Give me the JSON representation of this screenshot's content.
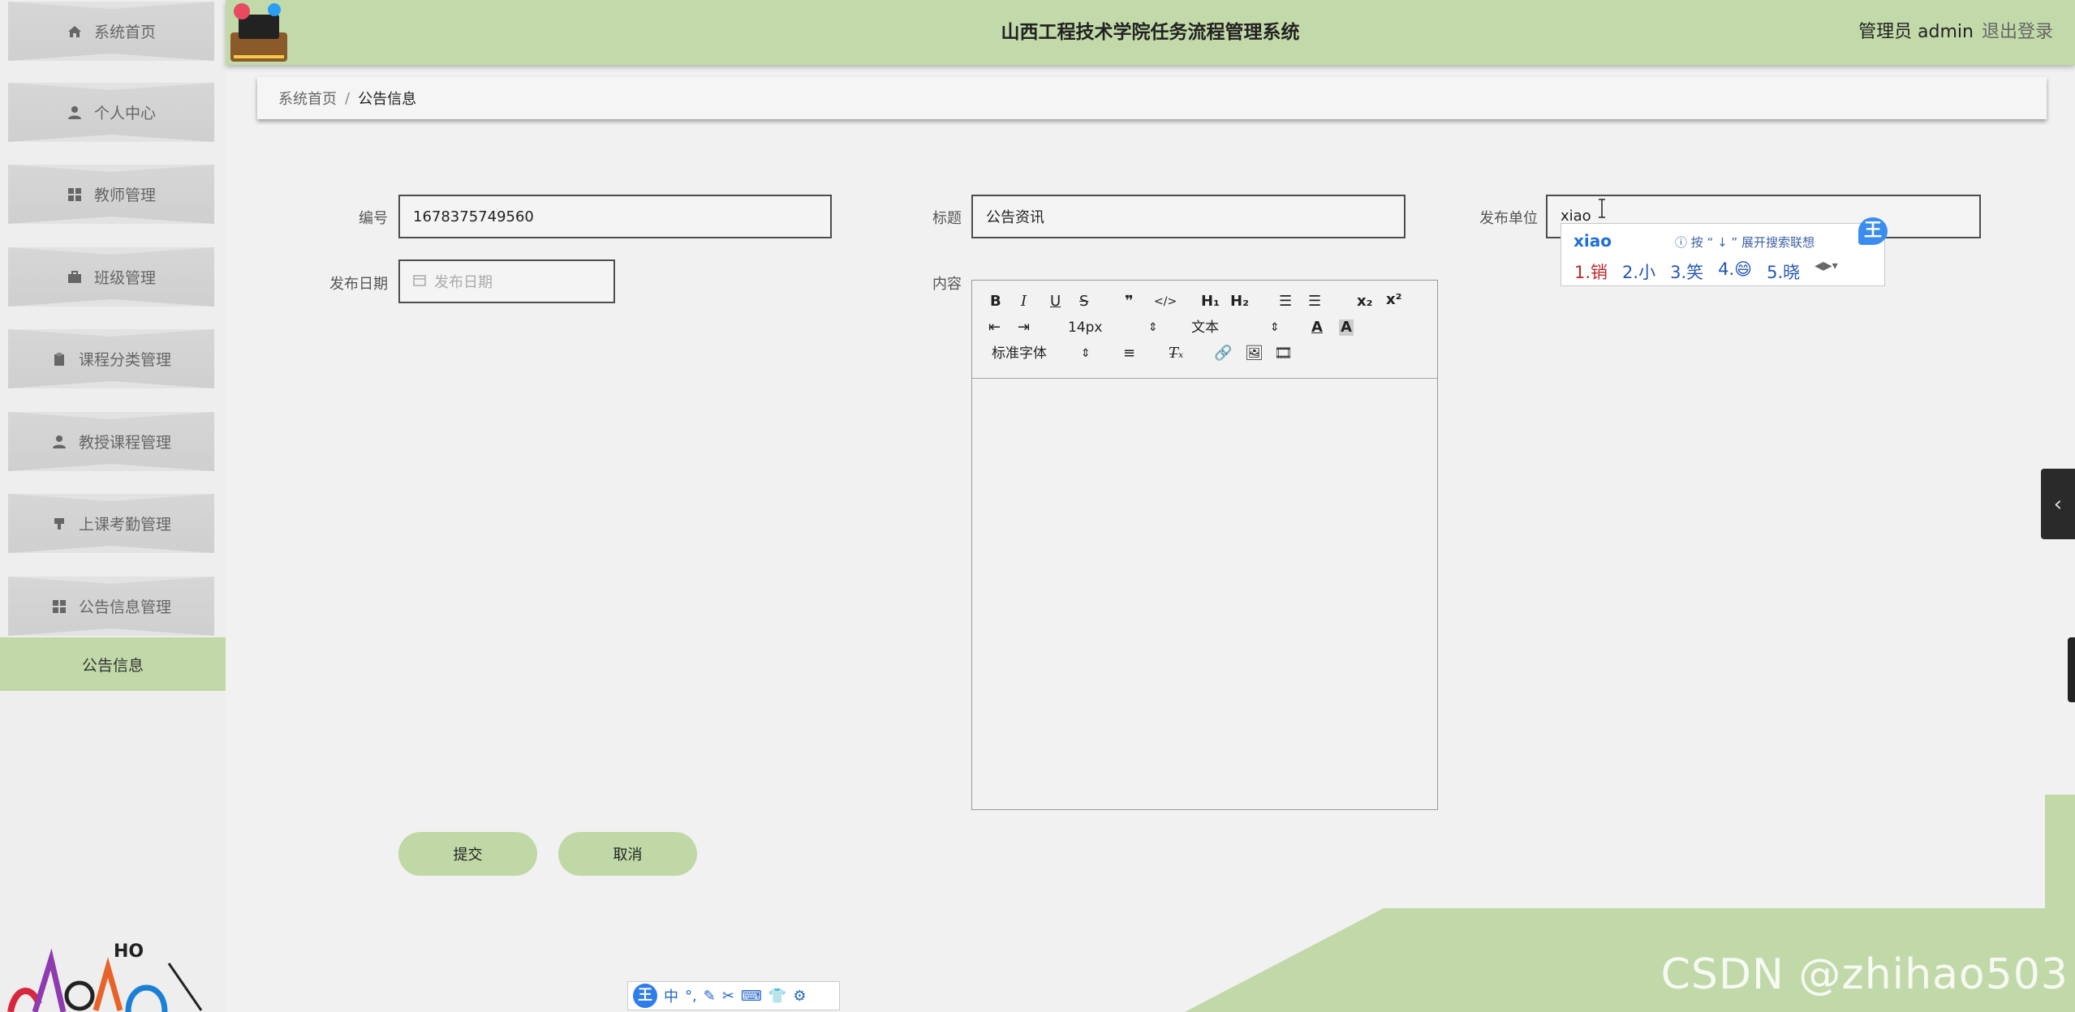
{
  "header": {
    "title": "山西工程技术学院任务流程管理系统",
    "user": "管理员 admin",
    "logout": "退出登录"
  },
  "sidebar": {
    "items": [
      {
        "label": "系统首页",
        "icon": "home-icon"
      },
      {
        "label": "个人中心",
        "icon": "user-icon"
      },
      {
        "label": "教师管理",
        "icon": "grid-icon"
      },
      {
        "label": "班级管理",
        "icon": "briefcase-icon"
      },
      {
        "label": "课程分类管理",
        "icon": "clipboard-icon"
      },
      {
        "label": "教授课程管理",
        "icon": "user-icon"
      },
      {
        "label": "上课考勤管理",
        "icon": "stamp-icon"
      },
      {
        "label": "公告信息管理",
        "icon": "grid-icon"
      }
    ],
    "active_sub": "公告信息",
    "logo_text": "HO"
  },
  "breadcrumb": {
    "home": "系统首页",
    "separator": "/",
    "current": "公告信息"
  },
  "form": {
    "id_label": "编号",
    "id_value": "1678375749560",
    "title_label": "标题",
    "title_value": "公告资讯",
    "publisher_label": "发布单位",
    "publisher_value": "xiao",
    "date_label": "发布日期",
    "date_placeholder": "发布日期",
    "content_label": "内容"
  },
  "editor": {
    "font_size": "14px",
    "block_format": "文本",
    "font_family": "标准字体",
    "tools": [
      "B",
      "I",
      "U",
      "S",
      "quote",
      "code",
      "H1",
      "H2",
      "ordered-list",
      "bullet-list",
      "subscript",
      "superscript",
      "outdent",
      "indent",
      "font-color",
      "background-color",
      "align",
      "clear-format",
      "link",
      "image",
      "video"
    ]
  },
  "buttons": {
    "submit": "提交",
    "cancel": "取消"
  },
  "ime": {
    "pinyin": "xiao",
    "hint": "按 “ ↓ ” 展开搜索联想",
    "candidates": [
      "1.销",
      "2.小",
      "3.笑",
      "4.😄",
      "5.晓"
    ],
    "logo": "王",
    "bar_items": [
      "王",
      "中",
      "°,",
      "✎",
      "✂",
      "⌨",
      "👕",
      "⚙"
    ]
  },
  "watermark": "CSDN @zhihao503",
  "colors": {
    "accent_green": "#c2d9a9",
    "sidebar_button": "#d2d2d2",
    "background": "#f1f1f1"
  }
}
